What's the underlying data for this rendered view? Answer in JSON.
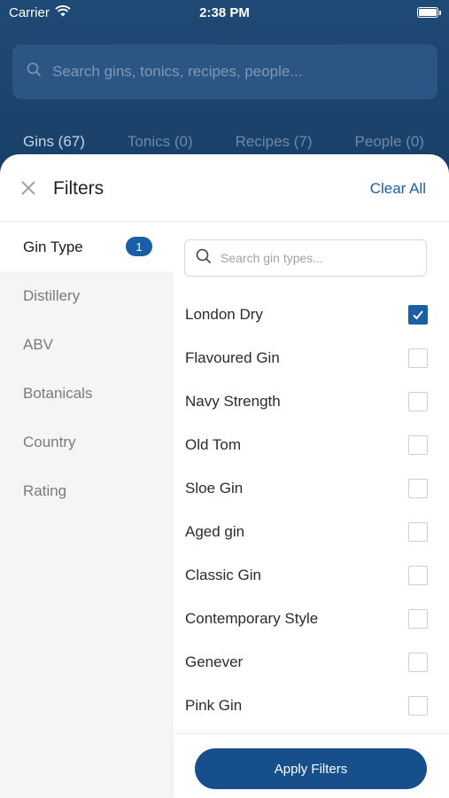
{
  "status_bar": {
    "carrier": "Carrier",
    "time": "2:38 PM"
  },
  "background": {
    "search_placeholder": "Search gins, tonics, recipes, people...",
    "tabs": [
      {
        "label": "Gins (67)",
        "active": true
      },
      {
        "label": "Tonics (0)",
        "active": false
      },
      {
        "label": "Recipes (7)",
        "active": false
      },
      {
        "label": "People (0)",
        "active": false
      }
    ]
  },
  "filters": {
    "title": "Filters",
    "clear_all": "Clear All",
    "categories": [
      {
        "label": "Gin Type",
        "active": true,
        "badge": "1"
      },
      {
        "label": "Distillery",
        "active": false
      },
      {
        "label": "ABV",
        "active": false
      },
      {
        "label": "Botanicals",
        "active": false
      },
      {
        "label": "Country",
        "active": false
      },
      {
        "label": "Rating",
        "active": false
      }
    ],
    "search_placeholder": "Search gin types...",
    "options": [
      {
        "label": "London Dry",
        "checked": true
      },
      {
        "label": "Flavoured Gin",
        "checked": false
      },
      {
        "label": "Navy Strength",
        "checked": false
      },
      {
        "label": "Old Tom",
        "checked": false
      },
      {
        "label": "Sloe Gin",
        "checked": false
      },
      {
        "label": "Aged gin",
        "checked": false
      },
      {
        "label": "Classic Gin",
        "checked": false
      },
      {
        "label": "Contemporary Style",
        "checked": false
      },
      {
        "label": "Genever",
        "checked": false
      },
      {
        "label": "Pink Gin",
        "checked": false
      }
    ],
    "apply_label": "Apply Filters"
  },
  "colors": {
    "accent": "#1a5fa6",
    "button": "#174f8c",
    "sidebar_bg": "#f5f5f6",
    "backdrop": "#183f66"
  },
  "icons": {
    "close": "close-icon",
    "search": "search-icon",
    "check": "checkmark-icon",
    "wifi": "wifi-icon",
    "battery": "battery-icon"
  }
}
